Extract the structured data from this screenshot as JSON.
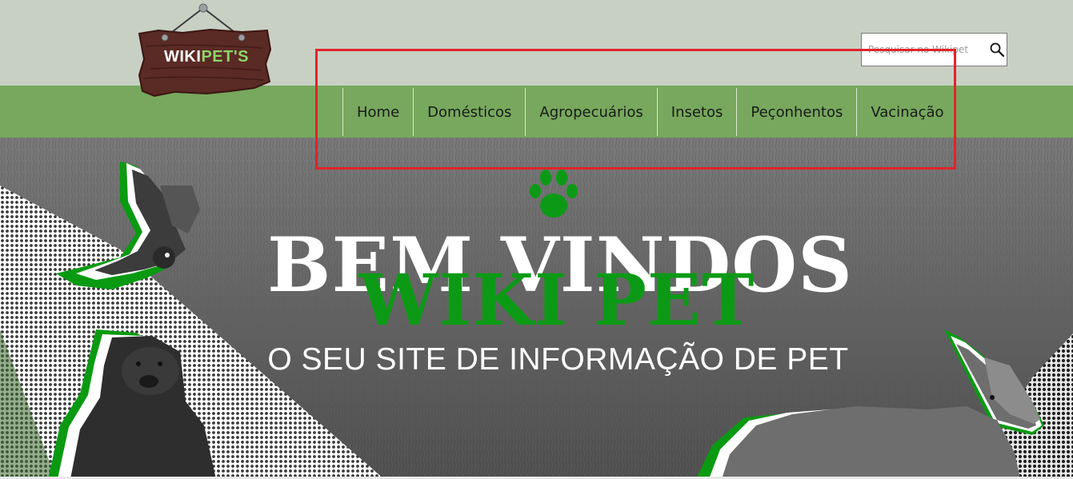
{
  "logo": {
    "text_white": "WIKI",
    "text_green": "PET'S"
  },
  "search": {
    "placeholder": "Pesquisar no Wikipet",
    "icon": "search-icon"
  },
  "nav": {
    "items": [
      {
        "label": "Home"
      },
      {
        "label": "Domésticos"
      },
      {
        "label": "Agropecuários"
      },
      {
        "label": "Insetos"
      },
      {
        "label": "Peçonhentos"
      },
      {
        "label": "Vacinação"
      }
    ]
  },
  "hero": {
    "paw_icon": "paw-icon",
    "title_line1": "BEM VINDOS",
    "title_line2": "WIKI PET",
    "subtitle": "O SEU SITE DE INFORMAÇÃO DE PET",
    "images": [
      "parrot-image",
      "dog-image",
      "horses-image"
    ]
  },
  "colors": {
    "topbar": "#c8d0c4",
    "navbar": "#77a85d",
    "accent_green": "#0c9a16",
    "highlight_red": "#e0242a",
    "logo_wood": "#5a2a24"
  }
}
